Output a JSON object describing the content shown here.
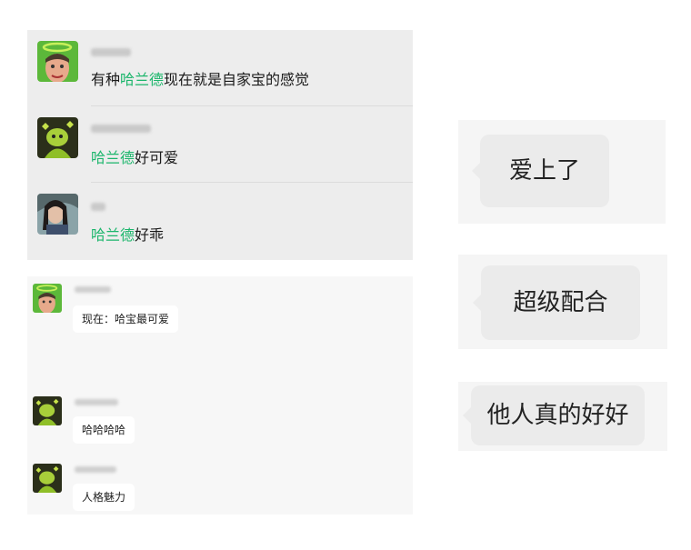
{
  "comments": [
    {
      "prefix": "有种",
      "highlight": "哈兰德",
      "suffix": "现在就是自家宝的感觉"
    },
    {
      "prefix": "",
      "highlight": "哈兰德",
      "suffix": "好可爱"
    },
    {
      "prefix": "",
      "highlight": "哈兰德",
      "suffix": "好乖"
    }
  ],
  "chat": [
    {
      "message": "现在：哈宝最可爱",
      "avatar": "green-hat-avatar"
    },
    {
      "message": "哈哈哈哈",
      "avatar": "green-doll-avatar"
    },
    {
      "message": "人格魅力",
      "avatar": "green-doll-avatar"
    }
  ],
  "bubbles": [
    {
      "text": "爱上了"
    },
    {
      "text": "超级配合"
    },
    {
      "text": "他人真的好好"
    }
  ],
  "colors": {
    "highlight": "#1cb66c",
    "list_bg": "#ededed",
    "bubble_bg": "#ebebeb"
  }
}
